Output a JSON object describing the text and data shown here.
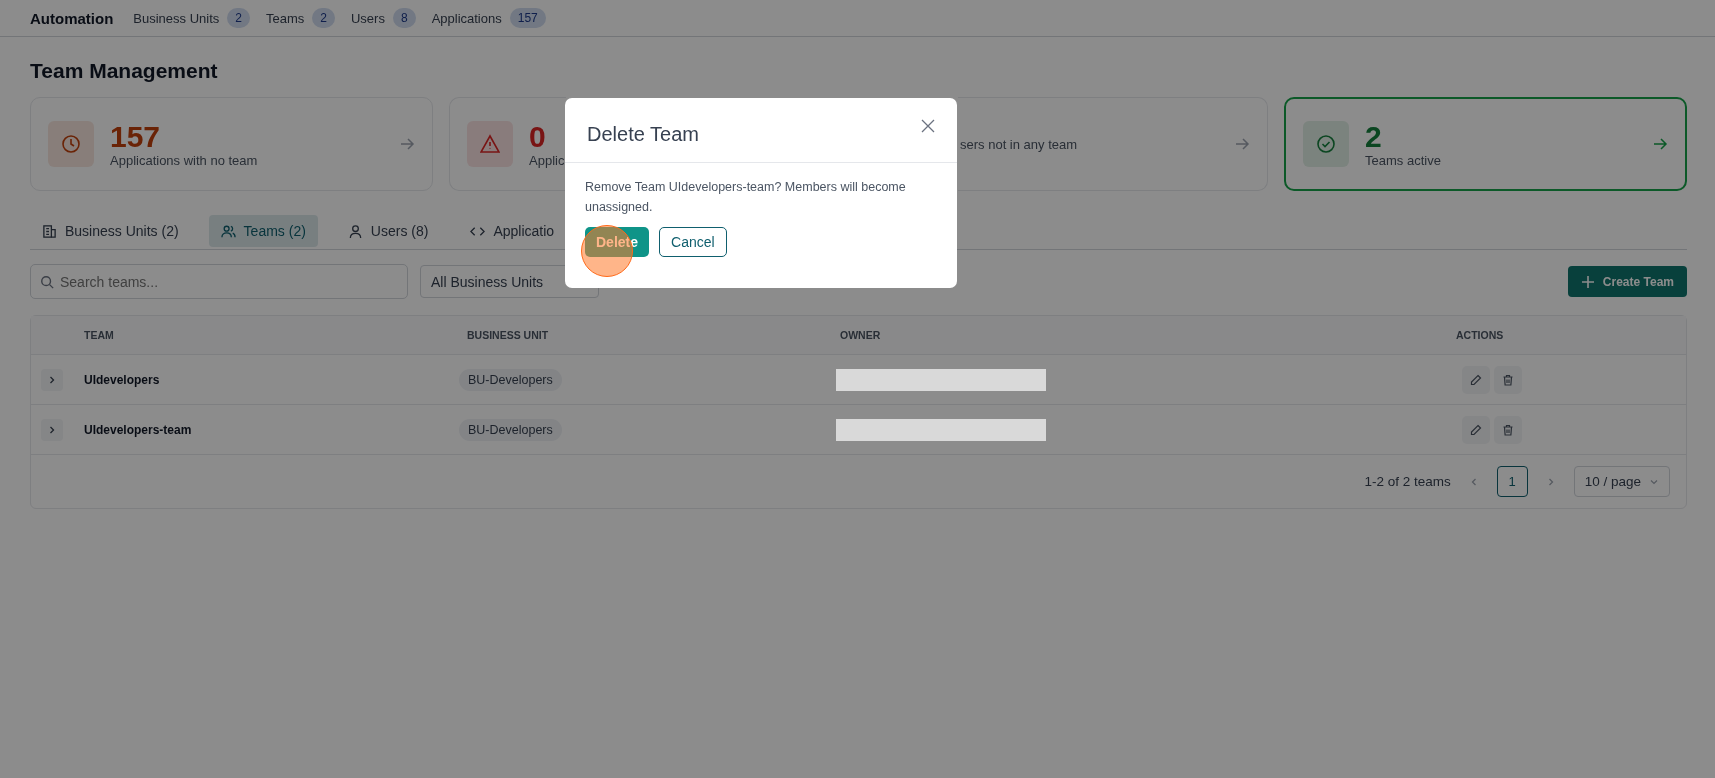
{
  "top_bar": {
    "title": "Automation",
    "links": [
      {
        "label": "Business Units",
        "count": "2"
      },
      {
        "label": "Teams",
        "count": "2"
      },
      {
        "label": "Users",
        "count": "8"
      },
      {
        "label": "Applications",
        "count": "157"
      }
    ]
  },
  "page_title": "Team Management",
  "stat_cards": [
    {
      "kind": "clock",
      "value": "157",
      "label": "Applications with no team",
      "arrow": true,
      "selected": false
    },
    {
      "kind": "warning",
      "value": "0",
      "label": "Applic",
      "arrow": false,
      "selected": false
    },
    {
      "label": "sers not in any team",
      "arrow": true,
      "selected": false
    },
    {
      "kind": "check",
      "value": "2",
      "label": "Teams active",
      "arrow": true,
      "selected": true
    }
  ],
  "tabs": [
    {
      "kind": "building",
      "label": "Business Units (2)",
      "selected": false
    },
    {
      "kind": "people",
      "label": "Teams (2)",
      "selected": true
    },
    {
      "kind": "person",
      "label": "Users (8)",
      "selected": false
    },
    {
      "kind": "code",
      "label": "Applicatio",
      "selected": false
    }
  ],
  "search": {
    "placeholder": "Search teams..."
  },
  "filter": {
    "value": "All Business Units"
  },
  "create_button": "Create Team",
  "table": {
    "columns": [
      "TEAM",
      "BUSINESS UNIT",
      "OWNER",
      "ACTIONS"
    ],
    "rows": [
      {
        "team": "UIdevelopers",
        "business_unit": "BU-Developers",
        "expanded": false
      },
      {
        "team": "UIdevelopers-team",
        "business_unit": "BU-Developers",
        "expanded": false
      }
    ]
  },
  "pagination": {
    "summary": "1-2 of 2 teams",
    "pages": [
      {
        "label": "1",
        "selected": true
      }
    ],
    "page_size": "10 / page"
  },
  "dialog": {
    "title": "Delete Team",
    "message": "Remove Team UIdevelopers-team? Members will become unassigned.",
    "buttons": [
      {
        "label": "Delete",
        "kind": "primary"
      },
      {
        "label": "Cancel",
        "kind": "secondary"
      }
    ]
  }
}
